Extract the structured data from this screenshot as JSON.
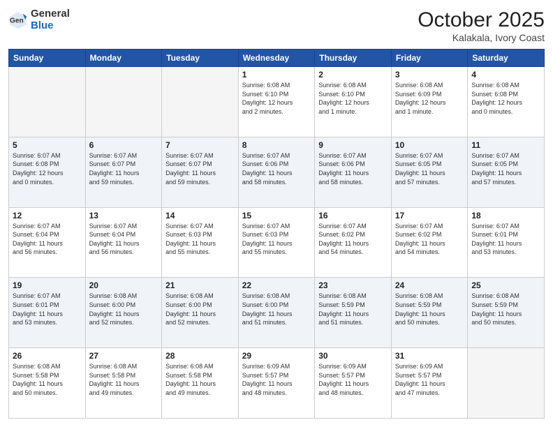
{
  "header": {
    "logo_general": "General",
    "logo_blue": "Blue",
    "month": "October 2025",
    "location": "Kalakala, Ivory Coast"
  },
  "weekdays": [
    "Sunday",
    "Monday",
    "Tuesday",
    "Wednesday",
    "Thursday",
    "Friday",
    "Saturday"
  ],
  "weeks": [
    [
      {
        "day": "",
        "info": "",
        "empty": true
      },
      {
        "day": "",
        "info": "",
        "empty": true
      },
      {
        "day": "",
        "info": "",
        "empty": true
      },
      {
        "day": "1",
        "info": "Sunrise: 6:08 AM\nSunset: 6:10 PM\nDaylight: 12 hours\nand 2 minutes.",
        "empty": false
      },
      {
        "day": "2",
        "info": "Sunrise: 6:08 AM\nSunset: 6:10 PM\nDaylight: 12 hours\nand 1 minute.",
        "empty": false
      },
      {
        "day": "3",
        "info": "Sunrise: 6:08 AM\nSunset: 6:09 PM\nDaylight: 12 hours\nand 1 minute.",
        "empty": false
      },
      {
        "day": "4",
        "info": "Sunrise: 6:08 AM\nSunset: 6:08 PM\nDaylight: 12 hours\nand 0 minutes.",
        "empty": false
      }
    ],
    [
      {
        "day": "5",
        "info": "Sunrise: 6:07 AM\nSunset: 6:08 PM\nDaylight: 12 hours\nand 0 minutes.",
        "empty": false
      },
      {
        "day": "6",
        "info": "Sunrise: 6:07 AM\nSunset: 6:07 PM\nDaylight: 11 hours\nand 59 minutes.",
        "empty": false
      },
      {
        "day": "7",
        "info": "Sunrise: 6:07 AM\nSunset: 6:07 PM\nDaylight: 11 hours\nand 59 minutes.",
        "empty": false
      },
      {
        "day": "8",
        "info": "Sunrise: 6:07 AM\nSunset: 6:06 PM\nDaylight: 11 hours\nand 58 minutes.",
        "empty": false
      },
      {
        "day": "9",
        "info": "Sunrise: 6:07 AM\nSunset: 6:06 PM\nDaylight: 11 hours\nand 58 minutes.",
        "empty": false
      },
      {
        "day": "10",
        "info": "Sunrise: 6:07 AM\nSunset: 6:05 PM\nDaylight: 11 hours\nand 57 minutes.",
        "empty": false
      },
      {
        "day": "11",
        "info": "Sunrise: 6:07 AM\nSunset: 6:05 PM\nDaylight: 11 hours\nand 57 minutes.",
        "empty": false
      }
    ],
    [
      {
        "day": "12",
        "info": "Sunrise: 6:07 AM\nSunset: 6:04 PM\nDaylight: 11 hours\nand 56 minutes.",
        "empty": false
      },
      {
        "day": "13",
        "info": "Sunrise: 6:07 AM\nSunset: 6:04 PM\nDaylight: 11 hours\nand 56 minutes.",
        "empty": false
      },
      {
        "day": "14",
        "info": "Sunrise: 6:07 AM\nSunset: 6:03 PM\nDaylight: 11 hours\nand 55 minutes.",
        "empty": false
      },
      {
        "day": "15",
        "info": "Sunrise: 6:07 AM\nSunset: 6:03 PM\nDaylight: 11 hours\nand 55 minutes.",
        "empty": false
      },
      {
        "day": "16",
        "info": "Sunrise: 6:07 AM\nSunset: 6:02 PM\nDaylight: 11 hours\nand 54 minutes.",
        "empty": false
      },
      {
        "day": "17",
        "info": "Sunrise: 6:07 AM\nSunset: 6:02 PM\nDaylight: 11 hours\nand 54 minutes.",
        "empty": false
      },
      {
        "day": "18",
        "info": "Sunrise: 6:07 AM\nSunset: 6:01 PM\nDaylight: 11 hours\nand 53 minutes.",
        "empty": false
      }
    ],
    [
      {
        "day": "19",
        "info": "Sunrise: 6:07 AM\nSunset: 6:01 PM\nDaylight: 11 hours\nand 53 minutes.",
        "empty": false
      },
      {
        "day": "20",
        "info": "Sunrise: 6:08 AM\nSunset: 6:00 PM\nDaylight: 11 hours\nand 52 minutes.",
        "empty": false
      },
      {
        "day": "21",
        "info": "Sunrise: 6:08 AM\nSunset: 6:00 PM\nDaylight: 11 hours\nand 52 minutes.",
        "empty": false
      },
      {
        "day": "22",
        "info": "Sunrise: 6:08 AM\nSunset: 6:00 PM\nDaylight: 11 hours\nand 51 minutes.",
        "empty": false
      },
      {
        "day": "23",
        "info": "Sunrise: 6:08 AM\nSunset: 5:59 PM\nDaylight: 11 hours\nand 51 minutes.",
        "empty": false
      },
      {
        "day": "24",
        "info": "Sunrise: 6:08 AM\nSunset: 5:59 PM\nDaylight: 11 hours\nand 50 minutes.",
        "empty": false
      },
      {
        "day": "25",
        "info": "Sunrise: 6:08 AM\nSunset: 5:59 PM\nDaylight: 11 hours\nand 50 minutes.",
        "empty": false
      }
    ],
    [
      {
        "day": "26",
        "info": "Sunrise: 6:08 AM\nSunset: 5:58 PM\nDaylight: 11 hours\nand 50 minutes.",
        "empty": false
      },
      {
        "day": "27",
        "info": "Sunrise: 6:08 AM\nSunset: 5:58 PM\nDaylight: 11 hours\nand 49 minutes.",
        "empty": false
      },
      {
        "day": "28",
        "info": "Sunrise: 6:08 AM\nSunset: 5:58 PM\nDaylight: 11 hours\nand 49 minutes.",
        "empty": false
      },
      {
        "day": "29",
        "info": "Sunrise: 6:09 AM\nSunset: 5:57 PM\nDaylight: 11 hours\nand 48 minutes.",
        "empty": false
      },
      {
        "day": "30",
        "info": "Sunrise: 6:09 AM\nSunset: 5:57 PM\nDaylight: 11 hours\nand 48 minutes.",
        "empty": false
      },
      {
        "day": "31",
        "info": "Sunrise: 6:09 AM\nSunset: 5:57 PM\nDaylight: 11 hours\nand 47 minutes.",
        "empty": false
      },
      {
        "day": "",
        "info": "",
        "empty": true
      }
    ]
  ]
}
